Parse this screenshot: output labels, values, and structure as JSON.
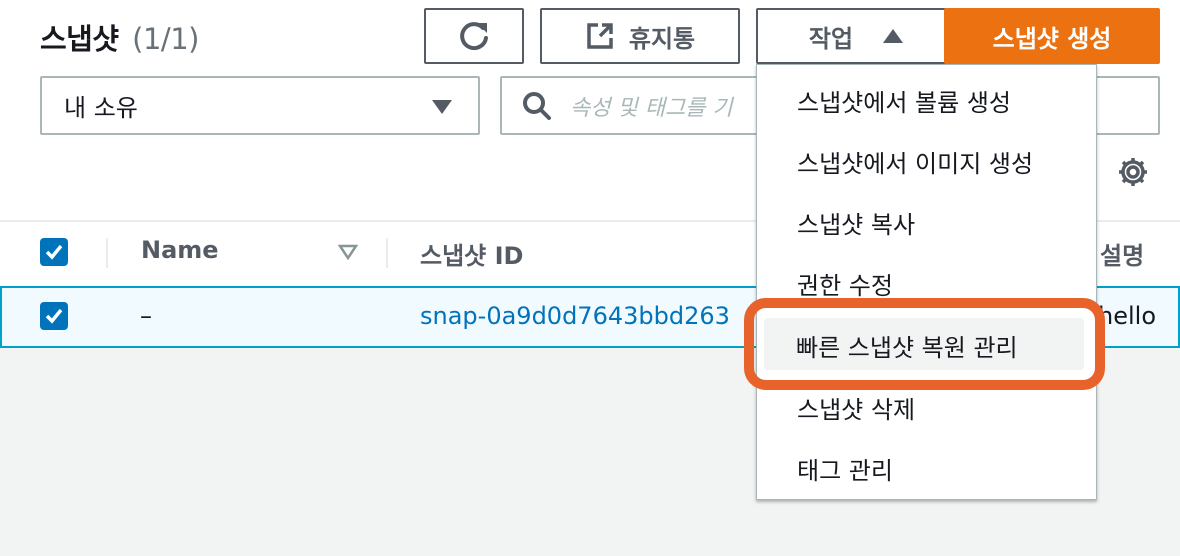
{
  "header": {
    "title": "스냅샷",
    "count": "(1/1)"
  },
  "toolbar": {
    "refresh_icon": "refresh-icon",
    "trash_label": "휴지통",
    "trash_icon": "external-link-icon",
    "actions_label": "작업",
    "create_label": "스냅샷 생성",
    "accent_color": "#ec7211"
  },
  "filter": {
    "owner_value": "내 소유",
    "search_placeholder": "속성 및 태그를 기"
  },
  "table": {
    "columns": [
      "Name",
      "스냅샷 ID",
      "설명"
    ],
    "rows": [
      {
        "selected": true,
        "name": "–",
        "snapshot_id": "snap-0a9d0d7643bbd263",
        "description": "hello"
      }
    ]
  },
  "actions_menu": {
    "items": [
      "스냅샷에서 볼륨 생성",
      "스냅샷에서 이미지 생성",
      "스냅샷 복사",
      "권한 수정",
      "빠른 스냅샷 복원 관리",
      "스냅샷 삭제",
      "태그 관리"
    ],
    "highlighted_item": "빠른 스냅샷 복원 관리",
    "highlight_color": "#e8622b"
  }
}
